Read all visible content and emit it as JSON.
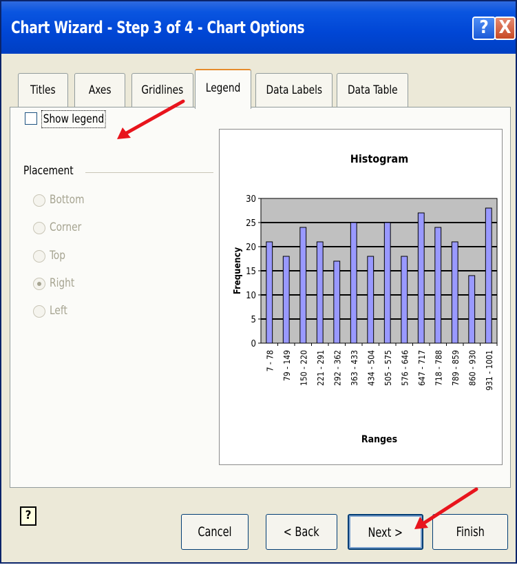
{
  "window": {
    "title": "Chart Wizard - Step 3 of 4 - Chart Options",
    "help_glyph": "?",
    "close_glyph": "X"
  },
  "tabs": [
    {
      "label": "Titles",
      "active": false
    },
    {
      "label": "Axes",
      "active": false
    },
    {
      "label": "Gridlines",
      "active": false
    },
    {
      "label": "Legend",
      "active": true
    },
    {
      "label": "Data Labels",
      "active": false
    },
    {
      "label": "Data Table",
      "active": false
    }
  ],
  "legend_options": {
    "show_legend_label": "Show legend",
    "show_legend_checked": false,
    "placement_label": "Placement",
    "placements": [
      {
        "label": "Bottom",
        "selected": false
      },
      {
        "label": "Corner",
        "selected": false
      },
      {
        "label": "Top",
        "selected": false
      },
      {
        "label": "Right",
        "selected": true
      },
      {
        "label": "Left",
        "selected": false
      }
    ],
    "placements_enabled": false
  },
  "buttons": {
    "help_glyph": "?",
    "cancel": "Cancel",
    "back": "< Back",
    "next": "Next >",
    "finish": "Finish"
  },
  "colors": {
    "titlebar": "#0046d5",
    "accent_arrow": "#e8141c",
    "bar_fill": "#9999ff",
    "plot_area": "#c0c0c0"
  },
  "chart_data": {
    "type": "bar",
    "title": "Histogram",
    "xlabel": "Ranges",
    "ylabel": "Frequency",
    "categories": [
      "7 - 78",
      "79 - 149",
      "150 - 220",
      "221 - 291",
      "292 - 362",
      "363 - 433",
      "434 - 504",
      "505 - 575",
      "576 - 646",
      "647 - 717",
      "718 - 788",
      "789 - 859",
      "860 - 930",
      "931 - 1001"
    ],
    "values": [
      21,
      18,
      24,
      21,
      17,
      25,
      18,
      25,
      18,
      27,
      24,
      21,
      14,
      28
    ],
    "ylim": [
      0,
      30
    ],
    "yticks": [
      0,
      5,
      10,
      15,
      20,
      25,
      30
    ],
    "grid": true,
    "legend": false
  }
}
